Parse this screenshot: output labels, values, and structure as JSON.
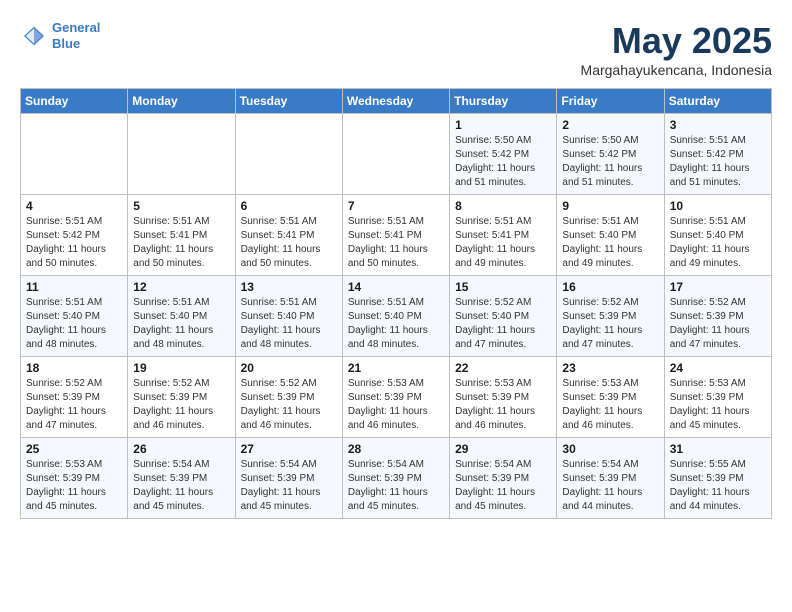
{
  "header": {
    "logo_line1": "General",
    "logo_line2": "Blue",
    "month": "May 2025",
    "location": "Margahayukencana, Indonesia"
  },
  "weekdays": [
    "Sunday",
    "Monday",
    "Tuesday",
    "Wednesday",
    "Thursday",
    "Friday",
    "Saturday"
  ],
  "weeks": [
    [
      {
        "day": "",
        "info": ""
      },
      {
        "day": "",
        "info": ""
      },
      {
        "day": "",
        "info": ""
      },
      {
        "day": "",
        "info": ""
      },
      {
        "day": "1",
        "info": "Sunrise: 5:50 AM\nSunset: 5:42 PM\nDaylight: 11 hours\nand 51 minutes."
      },
      {
        "day": "2",
        "info": "Sunrise: 5:50 AM\nSunset: 5:42 PM\nDaylight: 11 hours\nand 51 minutes."
      },
      {
        "day": "3",
        "info": "Sunrise: 5:51 AM\nSunset: 5:42 PM\nDaylight: 11 hours\nand 51 minutes."
      }
    ],
    [
      {
        "day": "4",
        "info": "Sunrise: 5:51 AM\nSunset: 5:42 PM\nDaylight: 11 hours\nand 50 minutes."
      },
      {
        "day": "5",
        "info": "Sunrise: 5:51 AM\nSunset: 5:41 PM\nDaylight: 11 hours\nand 50 minutes."
      },
      {
        "day": "6",
        "info": "Sunrise: 5:51 AM\nSunset: 5:41 PM\nDaylight: 11 hours\nand 50 minutes."
      },
      {
        "day": "7",
        "info": "Sunrise: 5:51 AM\nSunset: 5:41 PM\nDaylight: 11 hours\nand 50 minutes."
      },
      {
        "day": "8",
        "info": "Sunrise: 5:51 AM\nSunset: 5:41 PM\nDaylight: 11 hours\nand 49 minutes."
      },
      {
        "day": "9",
        "info": "Sunrise: 5:51 AM\nSunset: 5:40 PM\nDaylight: 11 hours\nand 49 minutes."
      },
      {
        "day": "10",
        "info": "Sunrise: 5:51 AM\nSunset: 5:40 PM\nDaylight: 11 hours\nand 49 minutes."
      }
    ],
    [
      {
        "day": "11",
        "info": "Sunrise: 5:51 AM\nSunset: 5:40 PM\nDaylight: 11 hours\nand 48 minutes."
      },
      {
        "day": "12",
        "info": "Sunrise: 5:51 AM\nSunset: 5:40 PM\nDaylight: 11 hours\nand 48 minutes."
      },
      {
        "day": "13",
        "info": "Sunrise: 5:51 AM\nSunset: 5:40 PM\nDaylight: 11 hours\nand 48 minutes."
      },
      {
        "day": "14",
        "info": "Sunrise: 5:51 AM\nSunset: 5:40 PM\nDaylight: 11 hours\nand 48 minutes."
      },
      {
        "day": "15",
        "info": "Sunrise: 5:52 AM\nSunset: 5:40 PM\nDaylight: 11 hours\nand 47 minutes."
      },
      {
        "day": "16",
        "info": "Sunrise: 5:52 AM\nSunset: 5:39 PM\nDaylight: 11 hours\nand 47 minutes."
      },
      {
        "day": "17",
        "info": "Sunrise: 5:52 AM\nSunset: 5:39 PM\nDaylight: 11 hours\nand 47 minutes."
      }
    ],
    [
      {
        "day": "18",
        "info": "Sunrise: 5:52 AM\nSunset: 5:39 PM\nDaylight: 11 hours\nand 47 minutes."
      },
      {
        "day": "19",
        "info": "Sunrise: 5:52 AM\nSunset: 5:39 PM\nDaylight: 11 hours\nand 46 minutes."
      },
      {
        "day": "20",
        "info": "Sunrise: 5:52 AM\nSunset: 5:39 PM\nDaylight: 11 hours\nand 46 minutes."
      },
      {
        "day": "21",
        "info": "Sunrise: 5:53 AM\nSunset: 5:39 PM\nDaylight: 11 hours\nand 46 minutes."
      },
      {
        "day": "22",
        "info": "Sunrise: 5:53 AM\nSunset: 5:39 PM\nDaylight: 11 hours\nand 46 minutes."
      },
      {
        "day": "23",
        "info": "Sunrise: 5:53 AM\nSunset: 5:39 PM\nDaylight: 11 hours\nand 46 minutes."
      },
      {
        "day": "24",
        "info": "Sunrise: 5:53 AM\nSunset: 5:39 PM\nDaylight: 11 hours\nand 45 minutes."
      }
    ],
    [
      {
        "day": "25",
        "info": "Sunrise: 5:53 AM\nSunset: 5:39 PM\nDaylight: 11 hours\nand 45 minutes."
      },
      {
        "day": "26",
        "info": "Sunrise: 5:54 AM\nSunset: 5:39 PM\nDaylight: 11 hours\nand 45 minutes."
      },
      {
        "day": "27",
        "info": "Sunrise: 5:54 AM\nSunset: 5:39 PM\nDaylight: 11 hours\nand 45 minutes."
      },
      {
        "day": "28",
        "info": "Sunrise: 5:54 AM\nSunset: 5:39 PM\nDaylight: 11 hours\nand 45 minutes."
      },
      {
        "day": "29",
        "info": "Sunrise: 5:54 AM\nSunset: 5:39 PM\nDaylight: 11 hours\nand 45 minutes."
      },
      {
        "day": "30",
        "info": "Sunrise: 5:54 AM\nSunset: 5:39 PM\nDaylight: 11 hours\nand 44 minutes."
      },
      {
        "day": "31",
        "info": "Sunrise: 5:55 AM\nSunset: 5:39 PM\nDaylight: 11 hours\nand 44 minutes."
      }
    ]
  ]
}
